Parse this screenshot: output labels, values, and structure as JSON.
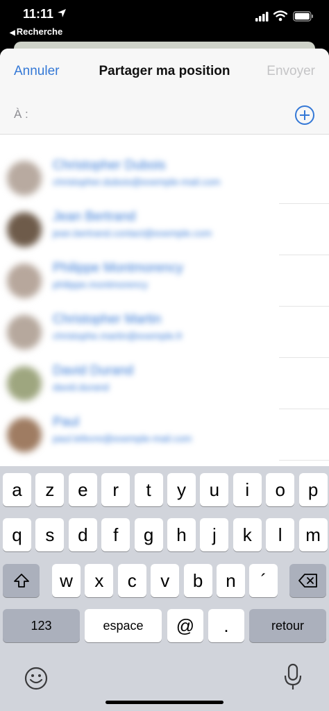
{
  "status_bar": {
    "time": "11:11",
    "back_app": "Recherche"
  },
  "navbar": {
    "cancel": "Annuler",
    "title": "Partager ma position",
    "send": "Envoyer"
  },
  "to_field": {
    "label": "À :",
    "value": ""
  },
  "contacts": [
    {
      "name": "Christopher Dubois",
      "detail": "christopher.dubois@exemple-mail.com",
      "avatar_color": "#b8aaa0"
    },
    {
      "name": "Jean Bertrand",
      "detail": "jean.bertrand.contact@exemple.com",
      "avatar_color": "#6e5b4a"
    },
    {
      "name": "Philippe Montmorency",
      "detail": "philippe.montmorency",
      "avatar_color": "#b7a79c"
    },
    {
      "name": "Christopher Martin",
      "detail": "christophe.martin@exemple.fr",
      "avatar_color": "#b6a89d"
    },
    {
      "name": "David Durand",
      "detail": "david.durand",
      "avatar_color": "#9ea67f"
    },
    {
      "name": "Paul",
      "detail": "paul.lefevre@exemple-mail.com",
      "avatar_color": "#9f7c62"
    }
  ],
  "keyboard": {
    "row1": [
      "a",
      "z",
      "e",
      "r",
      "t",
      "y",
      "u",
      "i",
      "o",
      "p"
    ],
    "row2": [
      "q",
      "s",
      "d",
      "f",
      "g",
      "h",
      "j",
      "k",
      "l",
      "m"
    ],
    "row3": [
      "w",
      "x",
      "c",
      "v",
      "b",
      "n",
      "´"
    ],
    "bottom": {
      "numbers": "123",
      "space": "espace",
      "at": "@",
      "dot": ".",
      "return": "retour"
    }
  }
}
